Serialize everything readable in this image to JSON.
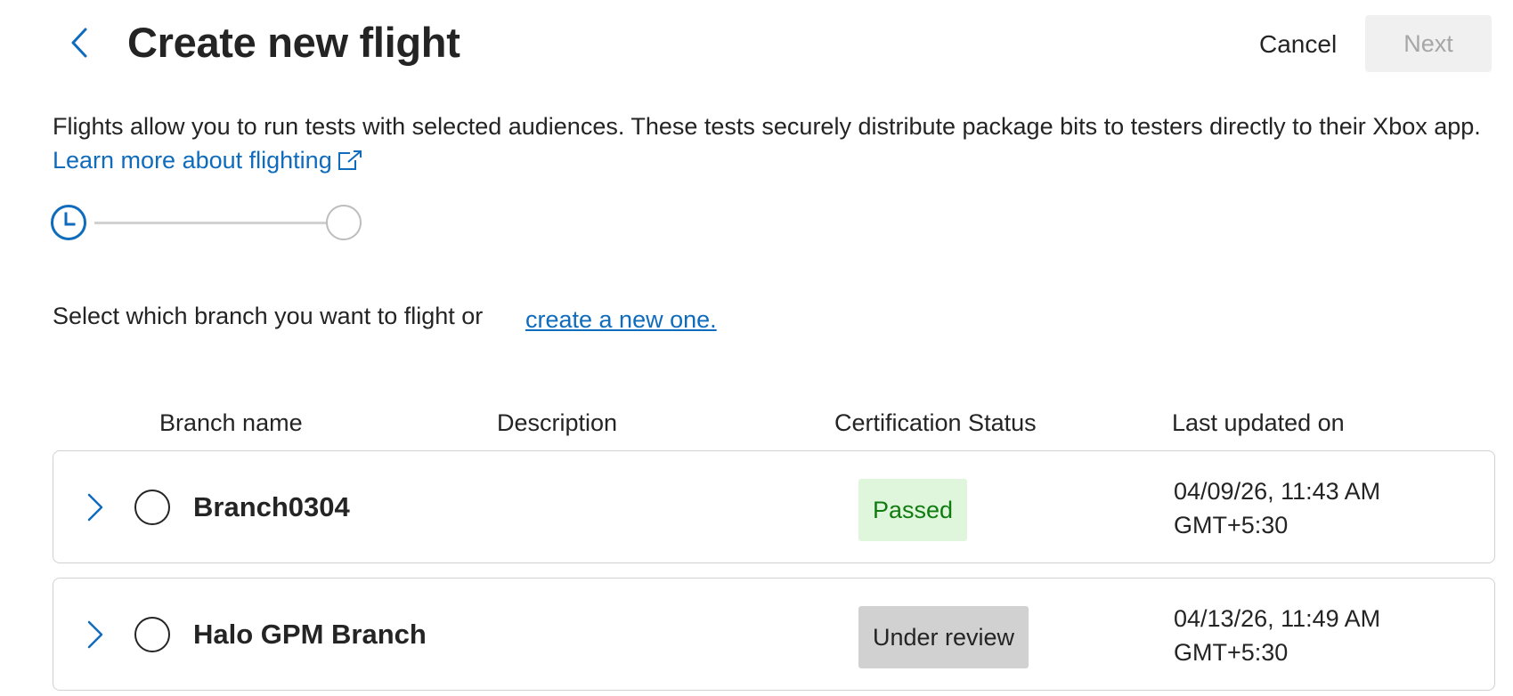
{
  "header": {
    "title": "Create new flight",
    "cancel_label": "Cancel",
    "next_label": "Next"
  },
  "intro": {
    "text": "Flights allow you to run tests with selected audiences. These tests securely distribute package bits to testers directly to their Xbox app.",
    "link_label": "Learn more about flighting"
  },
  "stepper": {
    "current_step": 1,
    "total_steps": 2
  },
  "branch_select": {
    "prompt": "Select which branch you want to flight or",
    "create_link_label": "create a new one."
  },
  "table": {
    "columns": [
      "Branch name",
      "Description",
      "Certification Status",
      "Last updated on"
    ],
    "rows": [
      {
        "name": "Branch0304",
        "description": "",
        "status": "Passed",
        "updated_line1": "04/09/26, 11:43 AM",
        "updated_line2": "GMT+5:30"
      },
      {
        "name": "Halo GPM Branch",
        "description": "",
        "status": "Under review",
        "updated_line1": "04/13/26, 11:49 AM",
        "updated_line2": "GMT+5:30"
      }
    ]
  },
  "colors": {
    "accent": "#0f6cbd",
    "passed_bg": "#dff6dd",
    "passed_text": "#107c10",
    "review_bg": "#d1d1d1",
    "disabled_bg": "#f0f0f0"
  },
  "icons": {
    "back": "chevron-left-icon",
    "external_link": "external-link-icon",
    "step_current": "clock-icon",
    "expand": "chevron-right-icon"
  }
}
